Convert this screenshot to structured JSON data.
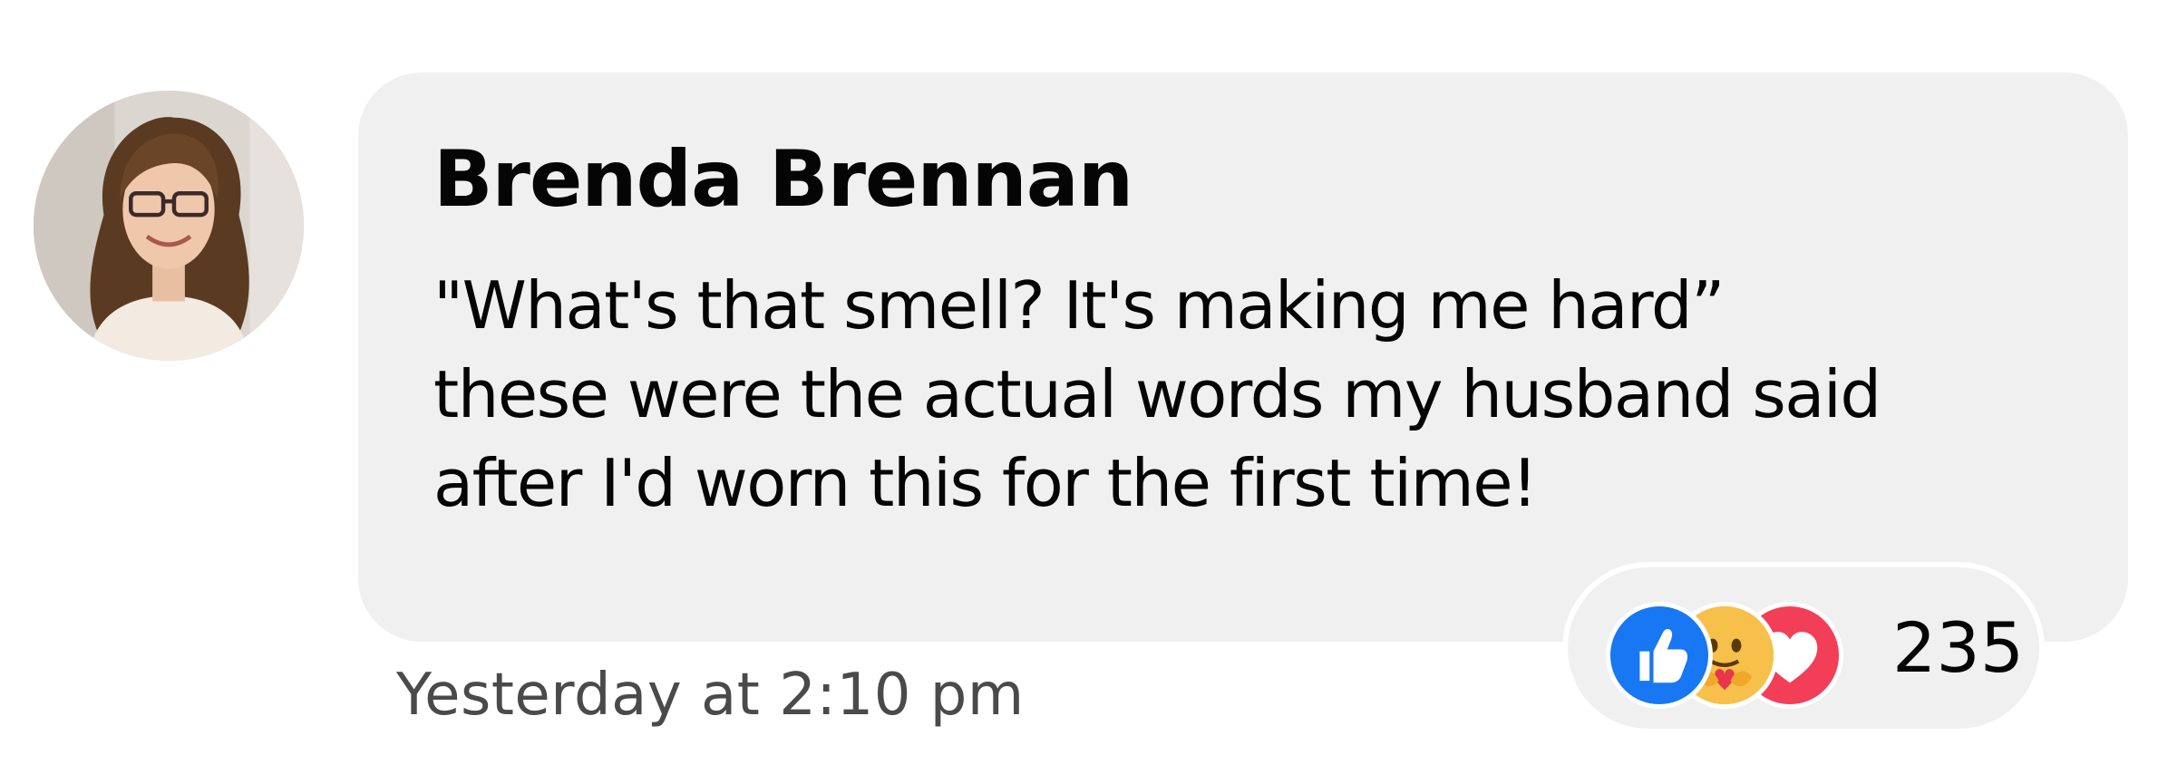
{
  "comment": {
    "author": "Brenda Brennan",
    "text_lines": [
      "\"What's that smell? It's making me hard”",
      "these were the actual words my husband said",
      "after I'd worn this for the first time!"
    ],
    "timestamp": "Yesterday at 2:10 pm",
    "avatar_icon": "profile-photo",
    "reactions": {
      "icons": [
        "like-icon",
        "care-icon",
        "love-icon"
      ],
      "count": "235"
    }
  },
  "colors": {
    "bubble_bg": "#f0f0f0",
    "like": "#1877f2",
    "care": "#f5b43b",
    "love": "#f33e58",
    "timestamp_text": "#4a4a4a"
  }
}
